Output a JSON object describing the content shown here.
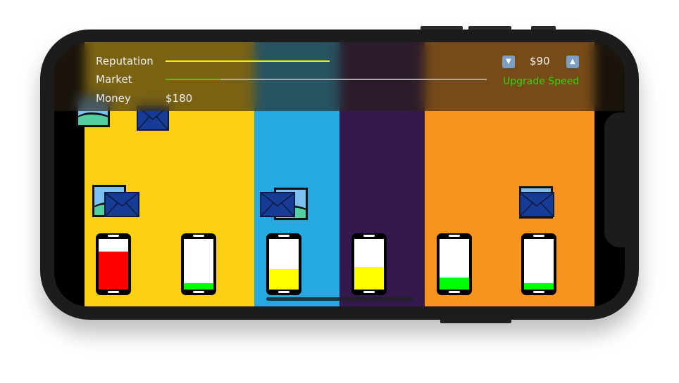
{
  "hud": {
    "reputation_label": "Reputation",
    "market_label": "Market",
    "money_label": "Money",
    "money_value": "$180",
    "reputation_level": 1.0,
    "market_level": 0.17,
    "price": "$90",
    "price_down_icon": "down-arrow-button-icon",
    "price_up_icon": "up-arrow-button-icon",
    "upgrade_label": "Upgrade Speed"
  },
  "colors": {
    "reputation": "#f5f000",
    "market": "#22dd00",
    "upgrade": "#22dd00",
    "lanes": [
      "#fcd012",
      "#26a9e1",
      "#34194f",
      "#f7931e"
    ]
  },
  "phones": [
    {
      "fill": 0.75,
      "color": "#ff0000"
    },
    {
      "fill": 0.12,
      "color": "#00ff00"
    },
    {
      "fill": 0.4,
      "color": "#ffff00"
    },
    {
      "fill": 0.45,
      "color": "#ffff00"
    },
    {
      "fill": 0.24,
      "color": "#00ff00"
    },
    {
      "fill": 0.12,
      "color": "#00ff00"
    }
  ]
}
